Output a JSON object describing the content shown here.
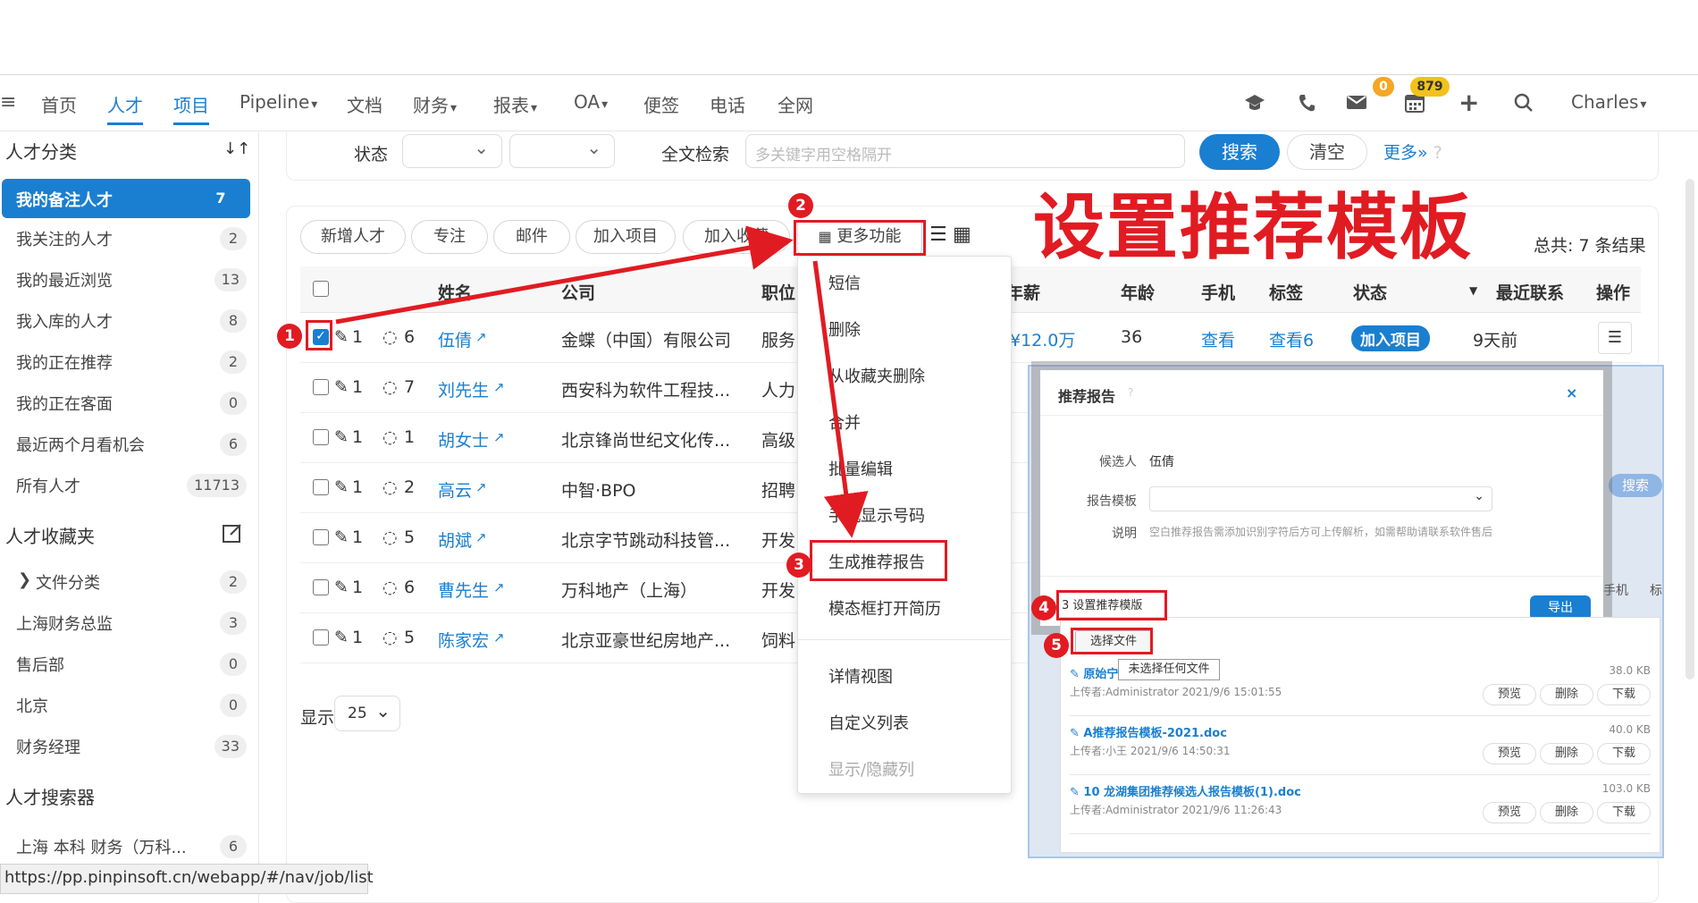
{
  "nav": {
    "menu_icon": "hamburger-icon",
    "items": [
      "首页",
      "人才",
      "项目",
      "Pipeline",
      "文档",
      "财务",
      "报表",
      "OA",
      "便签",
      "电话",
      "全网"
    ],
    "mail_badge": "0",
    "calendar_badge": "879",
    "user": "Charles"
  },
  "sidebar": {
    "title": "人才分类",
    "items": [
      {
        "label": "我的备注人才",
        "count": "7"
      },
      {
        "label": "我关注的人才",
        "count": "2"
      },
      {
        "label": "我的最近浏览",
        "count": "13"
      },
      {
        "label": "我入库的人才",
        "count": "8"
      },
      {
        "label": "我的正在推荐",
        "count": "2"
      },
      {
        "label": "我的正在客面",
        "count": "0"
      },
      {
        "label": "最近两个月看机会",
        "count": "6"
      },
      {
        "label": "所有人才",
        "count": "11713"
      }
    ],
    "fav_title": "人才收藏夹",
    "fav_items": [
      {
        "label": "文件分类",
        "count": "2"
      },
      {
        "label": "上海财务总监",
        "count": "3"
      },
      {
        "label": "售后部",
        "count": "0"
      },
      {
        "label": "北京",
        "count": "0"
      },
      {
        "label": "财务经理",
        "count": "33"
      }
    ],
    "search_title": "人才搜索器",
    "search_items": [
      {
        "label": "上海 本科 财务（万科...",
        "count": "6"
      }
    ]
  },
  "filter": {
    "status_label": "状态",
    "fulltext_label": "全文检索",
    "placeholder": "多关键字用空格隔开",
    "search_btn": "搜索",
    "clear_btn": "清空",
    "more": "更多"
  },
  "toolbar": {
    "buttons": [
      "新增人才",
      "专注",
      "邮件",
      "加入项目",
      "加入收藏"
    ],
    "more_functions": "更多功能",
    "total": "总共: 7 条结果"
  },
  "annotation_title": "设置推荐模板",
  "table": {
    "headers": [
      "姓名",
      "公司",
      "职位",
      "年薪",
      "年龄",
      "手机",
      "标签",
      "状态",
      "最近联系",
      "操作"
    ],
    "rows": [
      {
        "attach": "1",
        "comments": "6",
        "name": "伍倩",
        "company": "金蝶（中国）有限公司",
        "position": "服务",
        "checked": true,
        "salary": "¥12.0万",
        "age": "36",
        "phone": "查看",
        "tags": "查看6",
        "status": "加入项目",
        "last": "9天前"
      },
      {
        "attach": "1",
        "comments": "7",
        "name": "刘先生",
        "company": "西安科为软件工程技...",
        "position": "人力",
        "checked": false
      },
      {
        "attach": "1",
        "comments": "1",
        "name": "胡女士",
        "company": "北京锋尚世纪文化传...",
        "position": "高级",
        "checked": false
      },
      {
        "attach": "1",
        "comments": "2",
        "name": "高云",
        "company": "中智·BPO",
        "position": "招聘",
        "checked": false
      },
      {
        "attach": "1",
        "comments": "5",
        "name": "胡斌",
        "company": "北京字节跳动科技管...",
        "position": "开发",
        "checked": false
      },
      {
        "attach": "1",
        "comments": "6",
        "name": "曹先生",
        "company": "万科地产（上海）",
        "position": "开发",
        "checked": false
      },
      {
        "attach": "1",
        "comments": "5",
        "name": "陈家宏",
        "company": "北京亚豪世纪房地产...",
        "position": "饲料",
        "checked": false
      }
    ],
    "page_size_label": "显示",
    "page_size": "25"
  },
  "dropdown": {
    "items": [
      "短信",
      "删除",
      "从收藏夹删除",
      "合并",
      "批量编辑",
      "手机显示号码",
      "生成推荐报告",
      "模态框打开简历",
      "详情视图",
      "自定义列表",
      "显示/隐藏列"
    ]
  },
  "report_modal": {
    "title": "推荐报告",
    "candidate_label": "候选人",
    "candidate": "伍倩",
    "template_label": "报告模板",
    "desc_label": "说明",
    "desc": "空白推荐报告需添加识别字符后方可上传解析，如需帮助请联系软件售后",
    "set_template": "3 设置推荐模版",
    "export": "导出",
    "choose_file": "选择文件",
    "no_file": "未选择任何文件",
    "search_btn": "搜索",
    "side_col_1": "手机",
    "side_col_2": "标"
  },
  "files": [
    {
      "name": "原始宁",
      "uploader": "上传者:Administrator 2021/9/6 15:01:55",
      "size": "38.0 KB"
    },
    {
      "name": "A推荐报告模板-2021.doc",
      "uploader": "上传者:小王 2021/9/6 14:50:31",
      "size": "40.0 KB"
    },
    {
      "name": "10 龙湖集团推荐候选人报告模板(1).doc",
      "uploader": "上传者:Administrator 2021/9/6 11:26:43",
      "size": "103.0 KB"
    }
  ],
  "file_actions": [
    "预览",
    "删除",
    "下载"
  ],
  "annotations": [
    "1",
    "2",
    "3",
    "4",
    "5"
  ],
  "status_url": "https://pp.pinpinsoft.cn/webapp/#/nav/job/list",
  "colors": {
    "accent": "#1a7fd0",
    "annotation_red": "#e11b22",
    "badge_orange": "#f5a623",
    "badge_yellow": "#f2c21b"
  }
}
